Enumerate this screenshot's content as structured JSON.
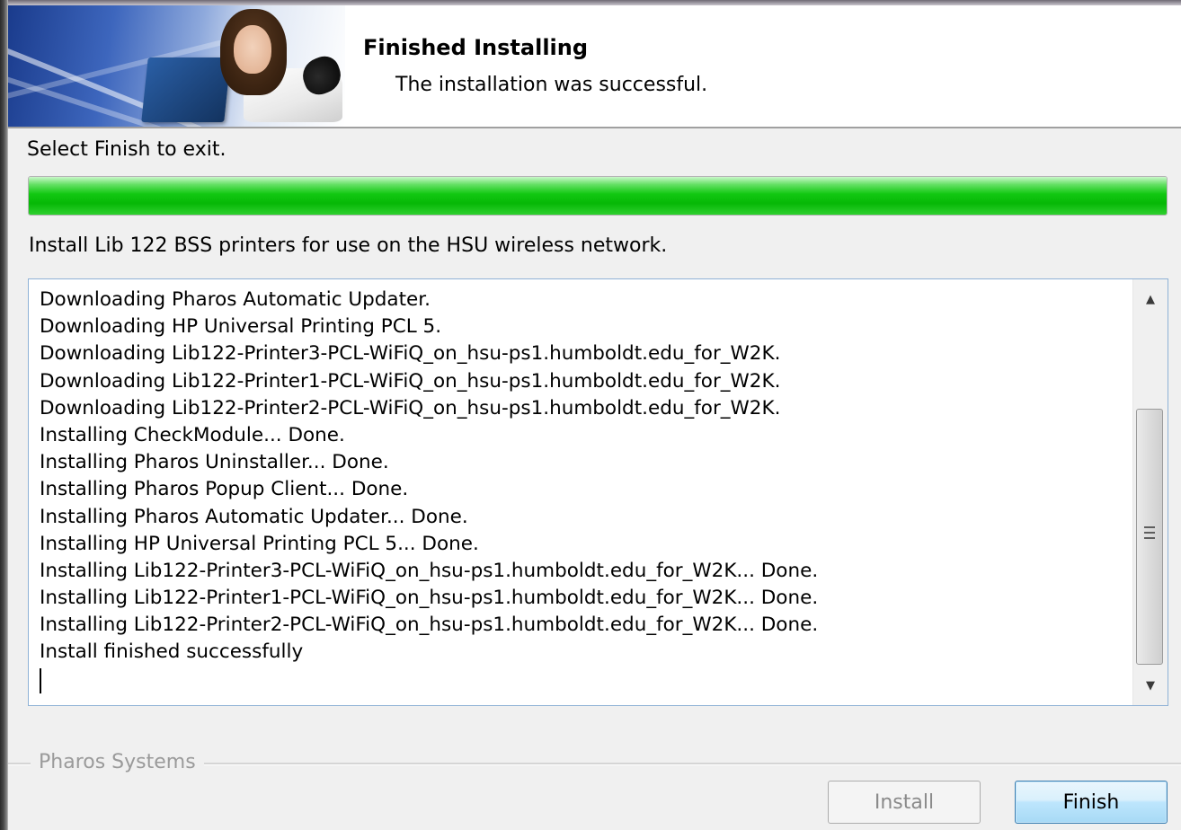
{
  "header": {
    "title": "Finished Installing",
    "subtitle": "The installation was successful."
  },
  "instruction": "Select Finish to exit.",
  "progress": {
    "percent": 100,
    "color": "#12c812"
  },
  "description": "Install Lib 122 BSS printers for use on the HSU wireless network.",
  "log": [
    "Downloading Pharos Automatic Updater.",
    "Downloading HP Universal Printing PCL 5.",
    "Downloading Lib122-Printer3-PCL-WiFiQ_on_hsu-ps1.humboldt.edu_for_W2K.",
    "Downloading Lib122-Printer1-PCL-WiFiQ_on_hsu-ps1.humboldt.edu_for_W2K.",
    "Downloading Lib122-Printer2-PCL-WiFiQ_on_hsu-ps1.humboldt.edu_for_W2K.",
    "Installing CheckModule... Done.",
    "Installing Pharos Uninstaller... Done.",
    "Installing Pharos Popup Client... Done.",
    "Installing Pharos Automatic Updater... Done.",
    "Installing HP Universal Printing PCL 5... Done.",
    "Installing Lib122-Printer3-PCL-WiFiQ_on_hsu-ps1.humboldt.edu_for_W2K... Done.",
    "Installing Lib122-Printer1-PCL-WiFiQ_on_hsu-ps1.humboldt.edu_for_W2K... Done.",
    "Installing Lib122-Printer2-PCL-WiFiQ_on_hsu-ps1.humboldt.edu_for_W2K... Done.",
    "Install finished successfully"
  ],
  "scrollbar": {
    "up_icon": "scroll-up-arrow-icon",
    "down_icon": "scroll-down-arrow-icon",
    "grip_icon": "scroll-grip-icon"
  },
  "footer": {
    "brand": "Pharos Systems",
    "install_label": "Install",
    "finish_label": "Finish"
  }
}
